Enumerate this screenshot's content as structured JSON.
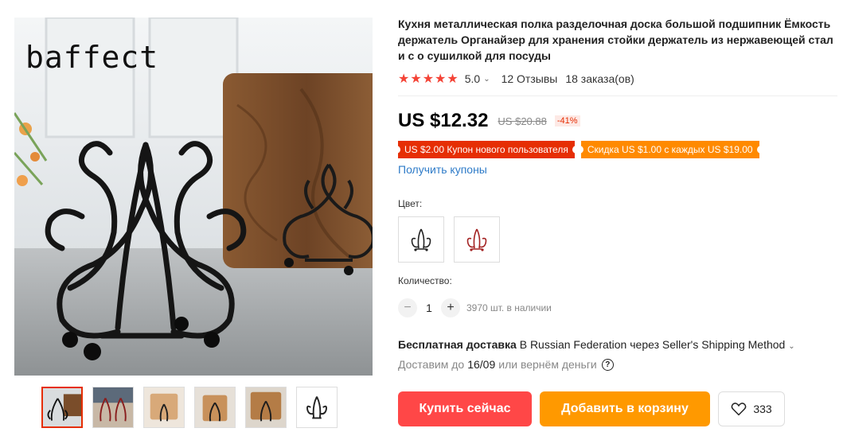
{
  "gallery": {
    "brand": "baffect",
    "thumbnails": [
      {
        "name": "thumb-1",
        "active": true
      },
      {
        "name": "thumb-2",
        "active": false
      },
      {
        "name": "thumb-3",
        "active": false
      },
      {
        "name": "thumb-4",
        "active": false
      },
      {
        "name": "thumb-5",
        "active": false
      },
      {
        "name": "thumb-6",
        "active": false
      }
    ]
  },
  "product": {
    "title": "Кухня металлическая полка разделочная доска большой подшипник Ёмкость держатель Органайзер для хранения стойки держатель из нержавеющей стали с о сушилкой для посуды",
    "rating": "5.0",
    "stars": 5,
    "reviews": "12 Отзывы",
    "orders": "18 заказа(ов)"
  },
  "price": {
    "current": "US $12.32",
    "old": "US $20.88",
    "discount": "-41%"
  },
  "coupons": {
    "new_user": "US $2.00 Купон нового пользователя",
    "store": "Скидка US $1.00 с каждых US $19.00",
    "get_link": "Получить купоны"
  },
  "color": {
    "label": "Цвет:",
    "options": [
      {
        "name": "black",
        "stroke": "#222222"
      },
      {
        "name": "red",
        "stroke": "#a32222"
      }
    ]
  },
  "quantity": {
    "label": "Количество:",
    "value": "1",
    "minus": "−",
    "plus": "+",
    "stock": "3970 шт. в наличии"
  },
  "shipping": {
    "free": "Бесплатная доставка",
    "details": "В Russian Federation через Seller's Shipping Method",
    "delivery_prefix": "Доставим до",
    "delivery_date": "16/09",
    "delivery_suffix": "или вернём деньги",
    "help_icon": "?"
  },
  "actions": {
    "buy": "Купить сейчас",
    "cart": "Добавить в корзину",
    "wishlist_count": "333"
  },
  "colors": {
    "accent_red": "#ff4747",
    "accent_orange": "#ff9900",
    "link_blue": "#2e7bc8",
    "star": "#f44336"
  }
}
